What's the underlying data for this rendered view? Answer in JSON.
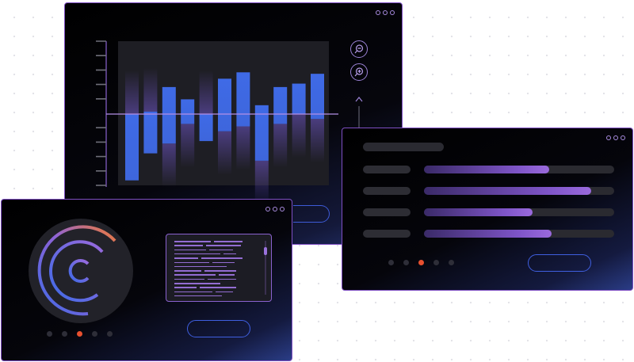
{
  "colors": {
    "accent_purple": "#8f63d6",
    "accent_blue": "#3f6ae6",
    "accent_orange": "#e8502f",
    "window_border": "#7f4fc4"
  },
  "chart_window": {
    "chart_data": {
      "type": "bar",
      "description_type": "floating-range",
      "categories": [
        "",
        "",
        "",
        "",
        "",
        "",
        "",
        "",
        "",
        "",
        ""
      ],
      "series": [
        {
          "ranges": [
            [
              -1.35,
              0.0
            ],
            [
              -0.8,
              0.05
            ],
            [
              0.55,
              -0.6
            ],
            [
              0.3,
              -0.2
            ],
            [
              -0.55,
              0.0
            ],
            [
              0.72,
              -0.35
            ],
            [
              0.85,
              -0.25
            ],
            [
              0.18,
              -0.95
            ],
            [
              0.55,
              -0.2
            ],
            [
              0.62,
              0.0
            ],
            [
              0.82,
              -0.1
            ]
          ]
        }
      ],
      "baseline": 0,
      "ylim": [
        -1.5,
        1.5
      ],
      "grid": false,
      "title": "",
      "xlabel": "",
      "ylabel": ""
    },
    "controls": [
      "zoom-out-icon",
      "zoom-in-icon",
      "scroll-up-icon"
    ]
  },
  "circle_window": {
    "gauge": {
      "rings": 3,
      "colors": [
        "#3f6ae6",
        "#8f63d6",
        "#e8702f"
      ]
    },
    "pager": {
      "count": 5,
      "active": 2
    }
  },
  "bars_window": {
    "rows": [
      {
        "level": 0.66
      },
      {
        "level": 0.88
      },
      {
        "level": 0.57
      },
      {
        "level": 0.67
      }
    ],
    "pager": {
      "count": 5,
      "active": 2
    }
  }
}
